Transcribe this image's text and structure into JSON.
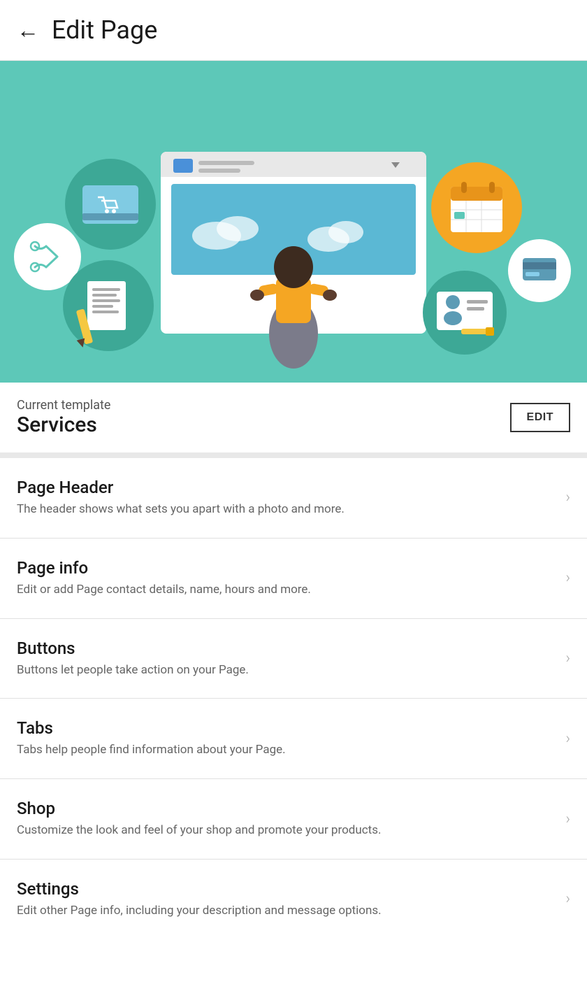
{
  "header": {
    "back_label": "←",
    "title": "Edit Page"
  },
  "template": {
    "label": "Current template",
    "name": "Services",
    "edit_button": "EDIT"
  },
  "menu_items": [
    {
      "id": "page-header",
      "title": "Page Header",
      "description": "The header shows what sets you apart with a photo and more."
    },
    {
      "id": "page-info",
      "title": "Page info",
      "description": "Edit or add Page contact details, name, hours and more."
    },
    {
      "id": "buttons",
      "title": "Buttons",
      "description": "Buttons let people take action on your Page."
    },
    {
      "id": "tabs",
      "title": "Tabs",
      "description": "Tabs help people find information about your Page."
    },
    {
      "id": "shop",
      "title": "Shop",
      "description": "Customize the look and feel of your shop and promote your products."
    },
    {
      "id": "settings",
      "title": "Settings",
      "description": "Edit other Page info, including your description and message options."
    }
  ],
  "colors": {
    "hero_bg": "#5DC8B8",
    "accent_teal": "#3BA898",
    "accent_yellow": "#F5A623",
    "accent_blue": "#4A90D9"
  },
  "icons": {
    "chevron": "›"
  }
}
